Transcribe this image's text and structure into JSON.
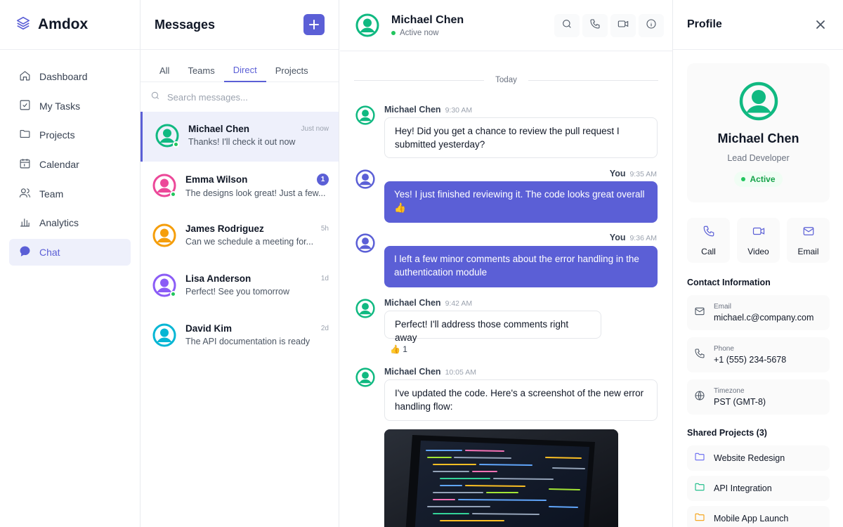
{
  "colors": {
    "accent": "#5b5fd6",
    "online": "#22c55e",
    "avatar_green": "#10b981",
    "avatar_pink": "#ec4899",
    "avatar_orange": "#f59e0b",
    "avatar_purple": "#8b5cf6",
    "avatar_cyan": "#06b6d4"
  },
  "brand": {
    "name": "Amdox",
    "icon": "layers-icon"
  },
  "sidebar": {
    "items": [
      {
        "label": "Dashboard",
        "icon": "home-icon"
      },
      {
        "label": "My Tasks",
        "icon": "checkbox-icon"
      },
      {
        "label": "Projects",
        "icon": "folder-icon"
      },
      {
        "label": "Calendar",
        "icon": "calendar-icon"
      },
      {
        "label": "Team",
        "icon": "users-icon"
      },
      {
        "label": "Analytics",
        "icon": "bar-chart-icon"
      },
      {
        "label": "Chat",
        "icon": "chat-bubble-icon",
        "active": true
      }
    ]
  },
  "messages": {
    "title": "Messages",
    "tabs": [
      "All",
      "Teams",
      "Direct",
      "Projects"
    ],
    "active_tab": "Direct",
    "search_placeholder": "Search messages...",
    "conversations": [
      {
        "name": "Michael Chen",
        "time": "Just now",
        "preview": "Thanks! I'll check it out now",
        "online": true,
        "active": true,
        "color": "green"
      },
      {
        "name": "Emma Wilson",
        "time": "",
        "unread": "1",
        "preview": "The designs look great! Just a few...",
        "online": true,
        "color": "pink"
      },
      {
        "name": "James Rodriguez",
        "time": "5h",
        "preview": "Can we schedule a meeting for...",
        "online": false,
        "color": "orange"
      },
      {
        "name": "Lisa Anderson",
        "time": "1d",
        "preview": "Perfect! See you tomorrow",
        "online": true,
        "color": "purple"
      },
      {
        "name": "David Kim",
        "time": "2d",
        "preview": "The API documentation is ready",
        "online": false,
        "color": "cyan"
      }
    ]
  },
  "chat": {
    "contact_name": "Michael Chen",
    "status": "Active now",
    "header_actions": [
      "search-icon",
      "phone-icon",
      "video-icon",
      "info-icon"
    ],
    "day_separator": "Today",
    "messages": [
      {
        "sender": "Michael Chen",
        "time": "9:30 AM",
        "text": "Hey! Did you get a chance to review the pull request I submitted yesterday?",
        "outgoing": false
      },
      {
        "sender": "You",
        "time": "9:35 AM",
        "text": "Yes! I just finished reviewing it. The code looks great overall 👍",
        "outgoing": true
      },
      {
        "sender": "You",
        "time": "9:36 AM",
        "text": "I left a few minor comments about the error handling in the authentication module",
        "outgoing": true
      },
      {
        "sender": "Michael Chen",
        "time": "9:42 AM",
        "text": "Perfect! I'll address those comments right away",
        "outgoing": false,
        "reaction": "👍 1"
      },
      {
        "sender": "Michael Chen",
        "time": "10:05 AM",
        "text": "I've updated the code. Here's a screenshot of the new error handling flow:",
        "outgoing": false,
        "attachment": "laptop-code-screenshot"
      }
    ]
  },
  "profile": {
    "title": "Profile",
    "name": "Michael Chen",
    "role": "Lead Developer",
    "status": "Active",
    "actions": [
      {
        "label": "Call",
        "icon": "phone-icon"
      },
      {
        "label": "Video",
        "icon": "video-icon"
      },
      {
        "label": "Email",
        "icon": "mail-icon"
      }
    ],
    "contact_title": "Contact Information",
    "contact": [
      {
        "label": "Email",
        "value": "michael.c@company.com",
        "icon": "mail-icon"
      },
      {
        "label": "Phone",
        "value": "+1 (555) 234-5678",
        "icon": "phone-icon"
      },
      {
        "label": "Timezone",
        "value": "PST (GMT-8)",
        "icon": "globe-icon"
      }
    ],
    "projects_title": "Shared Projects (3)",
    "projects": [
      {
        "name": "Website Redesign",
        "color": "#6366f1"
      },
      {
        "name": "API Integration",
        "color": "#10b981"
      },
      {
        "name": "Mobile App Launch",
        "color": "#f59e0b"
      }
    ]
  }
}
